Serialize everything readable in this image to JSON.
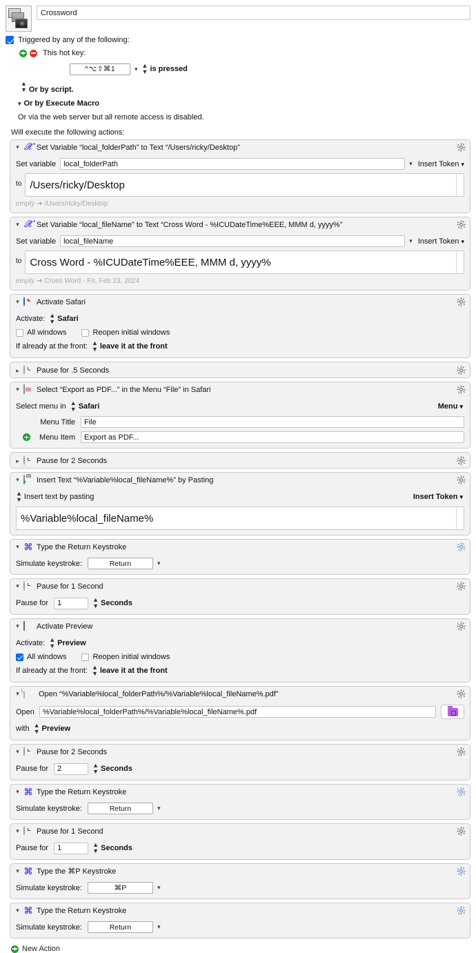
{
  "header": {
    "macro_icon": "stacked-windows-icon",
    "macro_name": "Crossword"
  },
  "trigger": {
    "checkbox_checked": true,
    "label": "Triggered by any of the following:",
    "hotkey_row_label": "This hot key:",
    "hotkey_value": "^⌥⇧⌘1",
    "hotkey_condition": "is pressed",
    "or_by_script": "Or by script.",
    "or_by_execute_macro": "Or by Execute Macro",
    "web_server_note": "Or via the web server but all remote access is disabled.",
    "will_execute": "Will execute the following actions:"
  },
  "actions": [
    {
      "icon": "set-variable-icon",
      "title": "Set Variable “local_folderPath” to Text “/Users/ricky/Desktop”",
      "collapsed": false,
      "type": "setvar",
      "field_label": "Set variable",
      "variable_name": "local_folderPath",
      "insert_token": "Insert Token",
      "to_label": "to",
      "value": "/Users/ricky/Desktop",
      "result_from": "empty",
      "result_to": "/Users/ricky/Desktop"
    },
    {
      "icon": "set-variable-icon",
      "title": "Set Variable “local_fileName” to Text “Cross Word  - %ICUDateTime%EEE, MMM d, yyyy%”",
      "collapsed": false,
      "type": "setvar",
      "field_label": "Set variable",
      "variable_name": "local_fileName",
      "insert_token": "Insert Token",
      "to_label": "to",
      "value": "Cross Word  - %ICUDateTime%EEE, MMM d, yyyy%",
      "result_from": "empty",
      "result_to": "Cross Word  - Fri, Feb 23, 2024"
    },
    {
      "icon": "safari-icon",
      "title": "Activate Safari",
      "collapsed": false,
      "type": "activate",
      "activate_label": "Activate:",
      "app": "Safari",
      "all_windows_label": "All windows",
      "all_windows_checked": false,
      "reopen_label": "Reopen initial windows",
      "reopen_checked": false,
      "front_label": "If already at the front:",
      "front_value": "leave it at the front"
    },
    {
      "icon": "clock-icon",
      "title": "Pause for .5 Seconds",
      "collapsed": true,
      "type": "pause-collapsed"
    },
    {
      "icon": "menu-icon",
      "title": "Select “Export as PDF...” in the Menu “File” in Safari",
      "collapsed": false,
      "type": "selectmenu",
      "select_label": "Select menu in",
      "app": "Safari",
      "menu_button": "Menu",
      "menu_title_label": "Menu Title",
      "menu_title_value": "File",
      "menu_item_label": "Menu Item",
      "menu_item_value": "Export as PDF..."
    },
    {
      "icon": "clock-icon",
      "title": "Pause for 2 Seconds",
      "collapsed": true,
      "type": "pause-collapsed"
    },
    {
      "icon": "clipboard-icon",
      "title": "Insert Text “%Variable%local_fileName%” by Pasting",
      "collapsed": false,
      "type": "inserttext",
      "mode": "Insert text by pasting",
      "insert_token": "Insert Token",
      "value": "%Variable%local_fileName%"
    },
    {
      "icon": "command-icon",
      "title": "Type the Return Keystroke",
      "collapsed": false,
      "type": "keystroke",
      "field_label": "Simulate keystroke:",
      "keystroke": "Return"
    },
    {
      "icon": "clock-icon",
      "title": "Pause for 1 Second",
      "collapsed": false,
      "type": "pause",
      "field_label": "Pause for",
      "value": "1",
      "units": "Seconds"
    },
    {
      "icon": "preview-icon",
      "title": "Activate Preview",
      "collapsed": false,
      "type": "activate",
      "activate_label": "Activate:",
      "app": "Preview",
      "all_windows_label": "All windows",
      "all_windows_checked": true,
      "reopen_label": "Reopen initial windows",
      "reopen_checked": false,
      "front_label": "If already at the front:",
      "front_value": "leave it at the front"
    },
    {
      "icon": "document-icon",
      "title": "Open “%Variable%local_folderPath%/%Variable%local_fileName%.pdf”",
      "collapsed": false,
      "type": "open",
      "open_label": "Open",
      "path": "%Variable%local_folderPath%/%Variable%local_fileName%.pdf",
      "folder_button": "folder-icon",
      "with_label": "with",
      "with_app": "Preview"
    },
    {
      "icon": "clock-icon",
      "title": "Pause for 2 Seconds",
      "collapsed": false,
      "type": "pause",
      "field_label": "Pause for",
      "value": "2",
      "units": "Seconds"
    },
    {
      "icon": "command-icon",
      "title": "Type the Return Keystroke",
      "collapsed": false,
      "type": "keystroke",
      "field_label": "Simulate keystroke:",
      "keystroke": "Return"
    },
    {
      "icon": "clock-icon",
      "title": "Pause for 1 Second",
      "collapsed": false,
      "type": "pause",
      "field_label": "Pause for",
      "value": "1",
      "units": "Seconds"
    },
    {
      "icon": "command-icon",
      "title": "Type the ⌘P Keystroke",
      "collapsed": false,
      "type": "keystroke",
      "field_label": "Simulate keystroke:",
      "keystroke": "⌘P"
    },
    {
      "icon": "command-icon",
      "title": "Type the Return Keystroke",
      "collapsed": false,
      "type": "keystroke",
      "field_label": "Simulate keystroke:",
      "keystroke": "Return"
    }
  ],
  "footer": {
    "new_action": "New Action"
  },
  "colors": {
    "accent_blue": "#0a6cf1",
    "icon_purple": "#5a5ad6",
    "green": "#1f9c2e",
    "red": "#d8352b",
    "action_bg": "#f2f2f2",
    "action_border": "#c9c9c9"
  }
}
